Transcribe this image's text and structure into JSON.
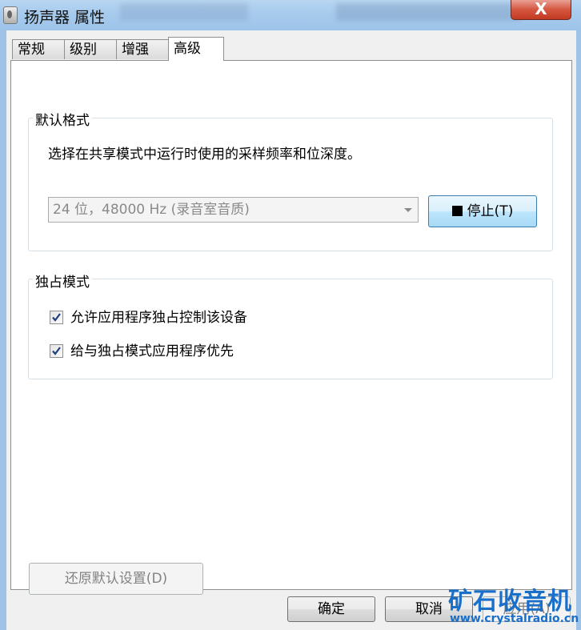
{
  "window": {
    "title": "扬声器 属性",
    "close_label": "X"
  },
  "tabs": [
    {
      "label": "常规",
      "active": false
    },
    {
      "label": "级别",
      "active": false
    },
    {
      "label": "增强",
      "active": false
    },
    {
      "label": "高级",
      "active": true
    }
  ],
  "default_format": {
    "title": "默认格式",
    "description": "选择在共享模式中运行时使用的采样频率和位深度。",
    "selected_format": "24 位，48000 Hz (录音室音质)",
    "stop_button": "停止(T)"
  },
  "exclusive_mode": {
    "title": "独占模式",
    "options": [
      {
        "label": "允许应用程序独占控制该设备",
        "checked": true
      },
      {
        "label": "给与独占模式应用程序优先",
        "checked": true
      }
    ]
  },
  "restore_defaults_label": "还原默认设置(D)",
  "footer": {
    "ok_label": "确定",
    "cancel_label": "取消",
    "apply_label": "应用(A)"
  },
  "watermark": {
    "title": "矿石收音机",
    "url": "www.crystalradio.cn"
  },
  "colors": {
    "accent": "#3c7fb1",
    "close": "#c23a22",
    "watermark": "#1a6fc9"
  }
}
